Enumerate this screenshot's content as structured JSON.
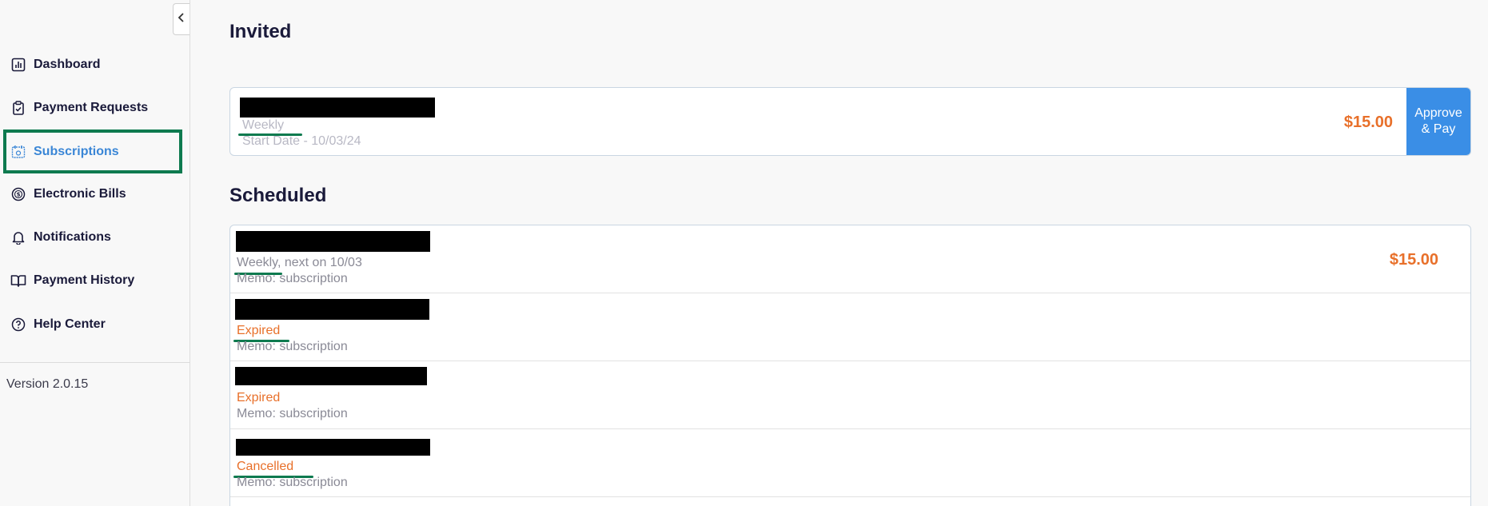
{
  "sidebar": {
    "collapse_icon": "chevron-left-icon",
    "items": [
      {
        "label": "Dashboard",
        "icon": "bar-chart-icon"
      },
      {
        "label": "Payment Requests",
        "icon": "clipboard-check-icon"
      },
      {
        "label": "Subscriptions",
        "icon": "calendar-icon",
        "active": true
      },
      {
        "label": "Electronic Bills",
        "icon": "dollar-circle-icon"
      },
      {
        "label": "Notifications",
        "icon": "bell-icon"
      },
      {
        "label": "Payment History",
        "icon": "book-icon"
      },
      {
        "label": "Help Center",
        "icon": "help-circle-icon"
      }
    ],
    "version": "Version 2.0.15"
  },
  "invited": {
    "title": "Invited",
    "item": {
      "frequency": "Weekly",
      "start_date": "Start Date - 10/03/24",
      "amount": "$15.00",
      "button_label_1": "Approve",
      "button_label_2": "& Pay"
    }
  },
  "scheduled": {
    "title": "Scheduled",
    "items": [
      {
        "status": "Weekly, next on 10/03",
        "memo": "Memo: subscription",
        "amount": "$15.00"
      },
      {
        "status": "Expired",
        "memo": "Memo: subscription",
        "amount": ""
      },
      {
        "status": "Expired",
        "memo": "Memo: subscription",
        "amount": ""
      },
      {
        "status": "Cancelled",
        "memo": "Memo: subscription",
        "amount": ""
      }
    ]
  },
  "colors": {
    "accent_blue": "#3a8ee6",
    "amount_orange": "#e8702a",
    "highlight_green": "#0e7a4f"
  }
}
